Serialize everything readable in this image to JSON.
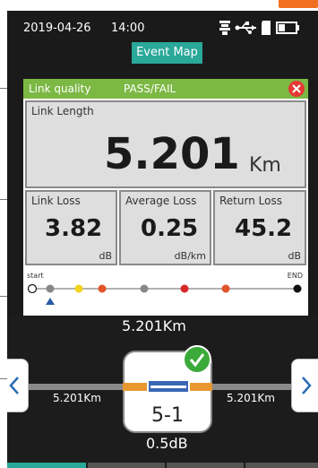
{
  "statusbar": {
    "date": "2019-04-26",
    "time": "14:00"
  },
  "title": "Event Map",
  "quality": {
    "label": "Link quality",
    "value": "PASS/FAIL"
  },
  "link_length": {
    "label": "Link Length",
    "value": "5.201",
    "unit": "Km"
  },
  "link_loss": {
    "label": "Link Loss",
    "value": "3.82",
    "unit": "dB"
  },
  "average_loss": {
    "label": "Average Loss",
    "value": "0.25",
    "unit": "dB/km"
  },
  "return_loss": {
    "label": "Return Loss",
    "value": "45.2",
    "unit": "dB"
  },
  "linkmap": {
    "start_label": "start",
    "end_label": "END",
    "markers": [
      {
        "color": "#ffffff",
        "name": "start"
      },
      {
        "color": "#888888",
        "name": "grey"
      },
      {
        "color": "#f2d21b",
        "name": "yellow"
      },
      {
        "color": "#e0552a",
        "name": "orange"
      },
      {
        "color": "#888888",
        "name": "grey"
      },
      {
        "color": "#d62a2a",
        "name": "red"
      },
      {
        "color": "#e0552a",
        "name": "orange"
      },
      {
        "color": "#111111",
        "name": "end"
      }
    ]
  },
  "event": {
    "top_distance": "5.201Km",
    "left_distance": "5.201Km",
    "right_distance": "5.201Km",
    "id": "5-1",
    "loss": "0.5dB"
  },
  "colors": {
    "accent": "#2aa89a",
    "pass": "#7cb844",
    "fail": "#e53935",
    "connector": "#3a66b5"
  }
}
